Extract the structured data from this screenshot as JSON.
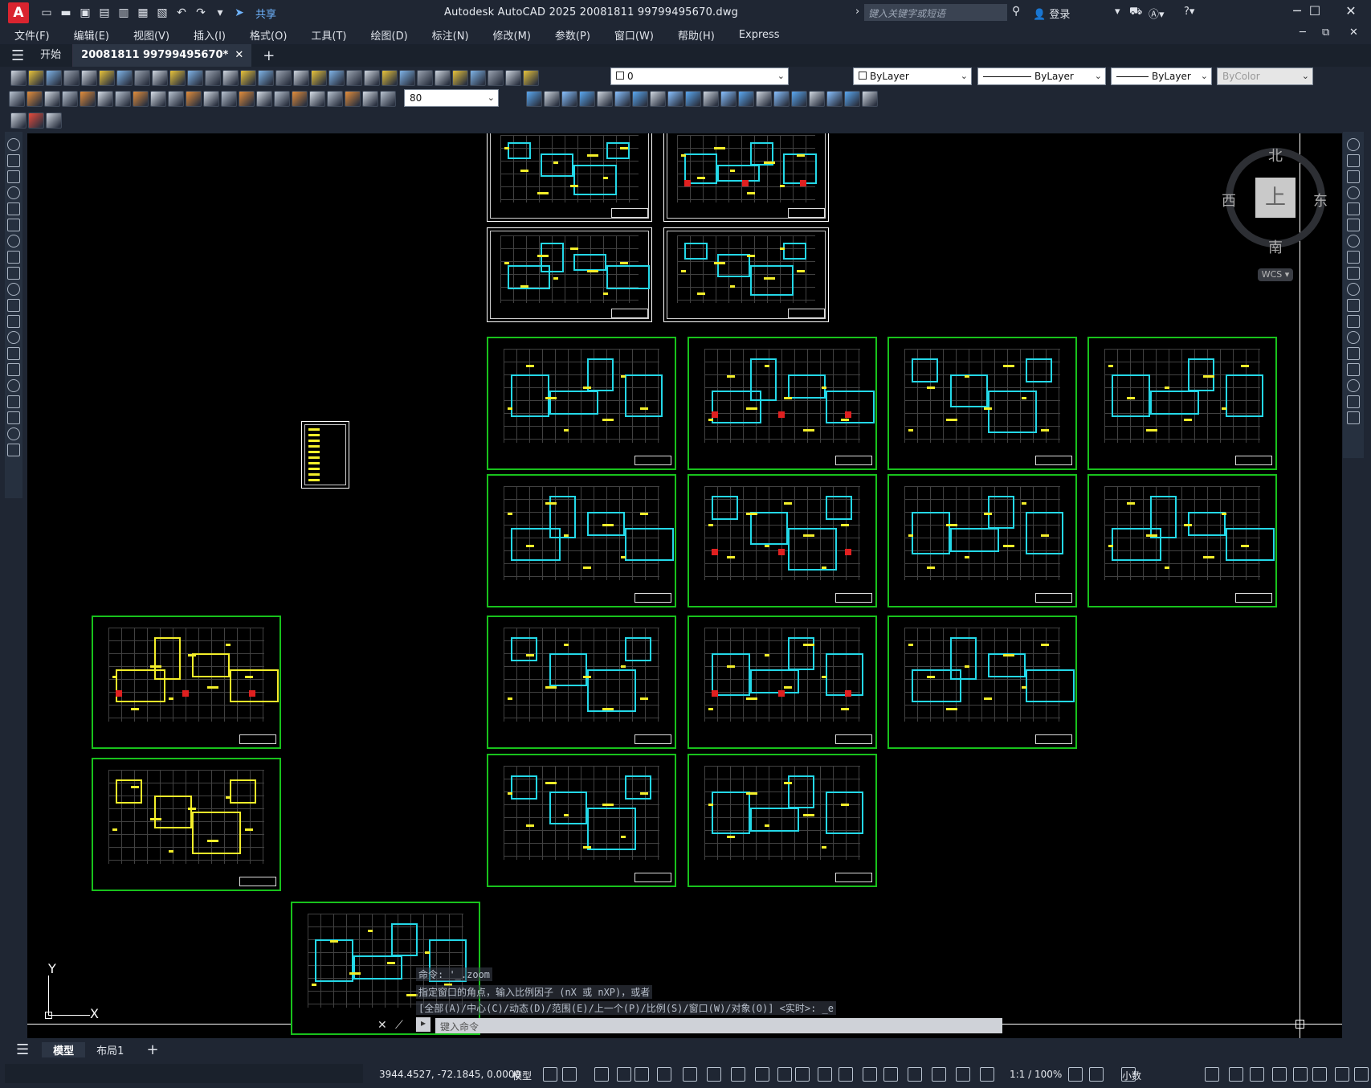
{
  "titlebar": {
    "logo": "A",
    "share_label": "共享",
    "app_title": "Autodesk AutoCAD 2025    20081811 99799495670.dwg",
    "search_placeholder": "键入关键字或短语",
    "login_label": "登录",
    "minimize": "─",
    "maximize": "☐",
    "close": "✕"
  },
  "menu": {
    "items": [
      "文件(F)",
      "编辑(E)",
      "视图(V)",
      "插入(I)",
      "格式(O)",
      "工具(T)",
      "绘图(D)",
      "标注(N)",
      "修改(M)",
      "参数(P)",
      "窗口(W)",
      "帮助(H)",
      "Express"
    ]
  },
  "tabs": {
    "home": "开始",
    "document": "20081811 99799495670*",
    "close": "✕",
    "add": "+"
  },
  "layer": {
    "current": "0",
    "color": "ByLayer",
    "linetype": "ByLayer",
    "lineweight": "ByLayer",
    "plotstyle": "ByColor"
  },
  "dimscale": "80",
  "viewcube": {
    "north": "北",
    "south": "南",
    "east": "东",
    "west": "西",
    "face": "上",
    "wcs": "WCS ▾"
  },
  "ucs": {
    "x": "X",
    "y": "Y"
  },
  "command": {
    "line1": "命令: '_.zoom",
    "line2": "指定窗口的角点，输入比例因子 (nX 或 nXP)，或者",
    "line3": "[全部(A)/中心(C)/动态(D)/范围(E)/上一个(P)/比例(S)/窗口(W)/对象(O)] <实时>: _e",
    "input_placeholder": "键入命令"
  },
  "layouts": {
    "model": "模型",
    "layout1": "布局1",
    "add": "+"
  },
  "status": {
    "coords": "3944.4527, -72.1845, 0.0000",
    "space": "模型",
    "scale": "1:1 / 100%",
    "units": "小数"
  }
}
